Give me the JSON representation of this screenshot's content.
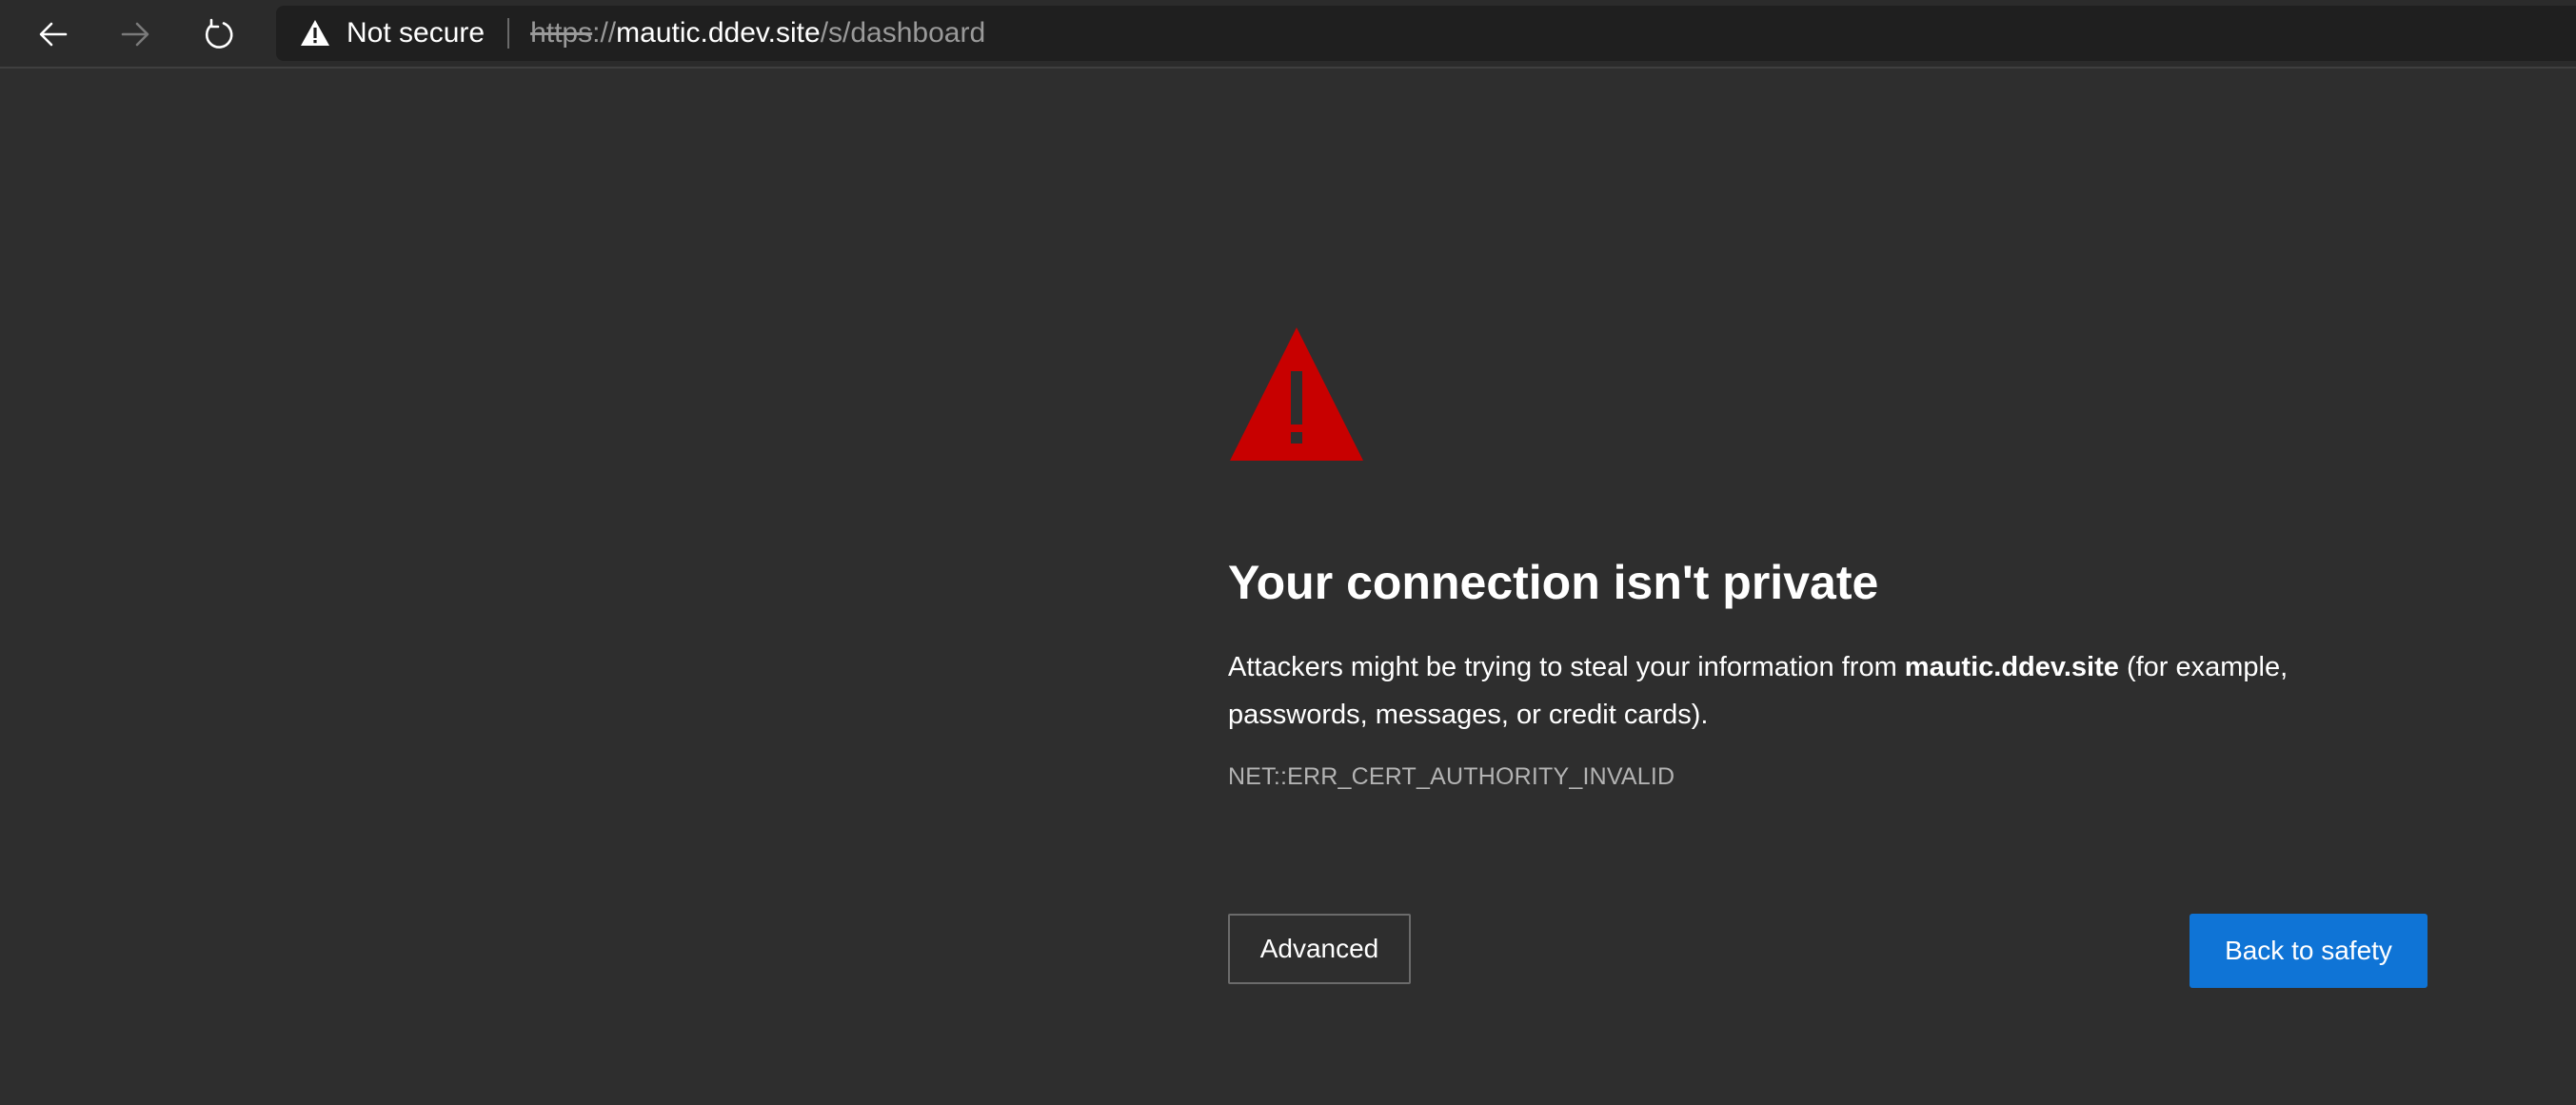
{
  "browser": {
    "nav": {
      "back_icon": "arrow-left-icon",
      "forward_icon": "arrow-right-icon",
      "refresh_icon": "refresh-icon"
    },
    "address_bar": {
      "security_icon": "warning-triangle-icon",
      "security_label": "Not secure",
      "url_scheme": "https",
      "url_separator": "://",
      "url_host": "mautic.ddev.site",
      "url_path": "/s/dashboard"
    }
  },
  "error_page": {
    "icon": "warning-triangle-icon",
    "heading": "Your connection isn't private",
    "description_prefix": "Attackers might be trying to steal your information from ",
    "description_host": "mautic.ddev.site",
    "description_suffix": " (for example, passwords, messages, or credit cards).",
    "error_code": "NET::ERR_CERT_AUTHORITY_INVALID",
    "advanced_label": "Advanced",
    "back_label": "Back to safety"
  },
  "colors": {
    "background": "#2e2e2e",
    "warning_red": "#c80000",
    "primary_button": "#0f74d6"
  }
}
